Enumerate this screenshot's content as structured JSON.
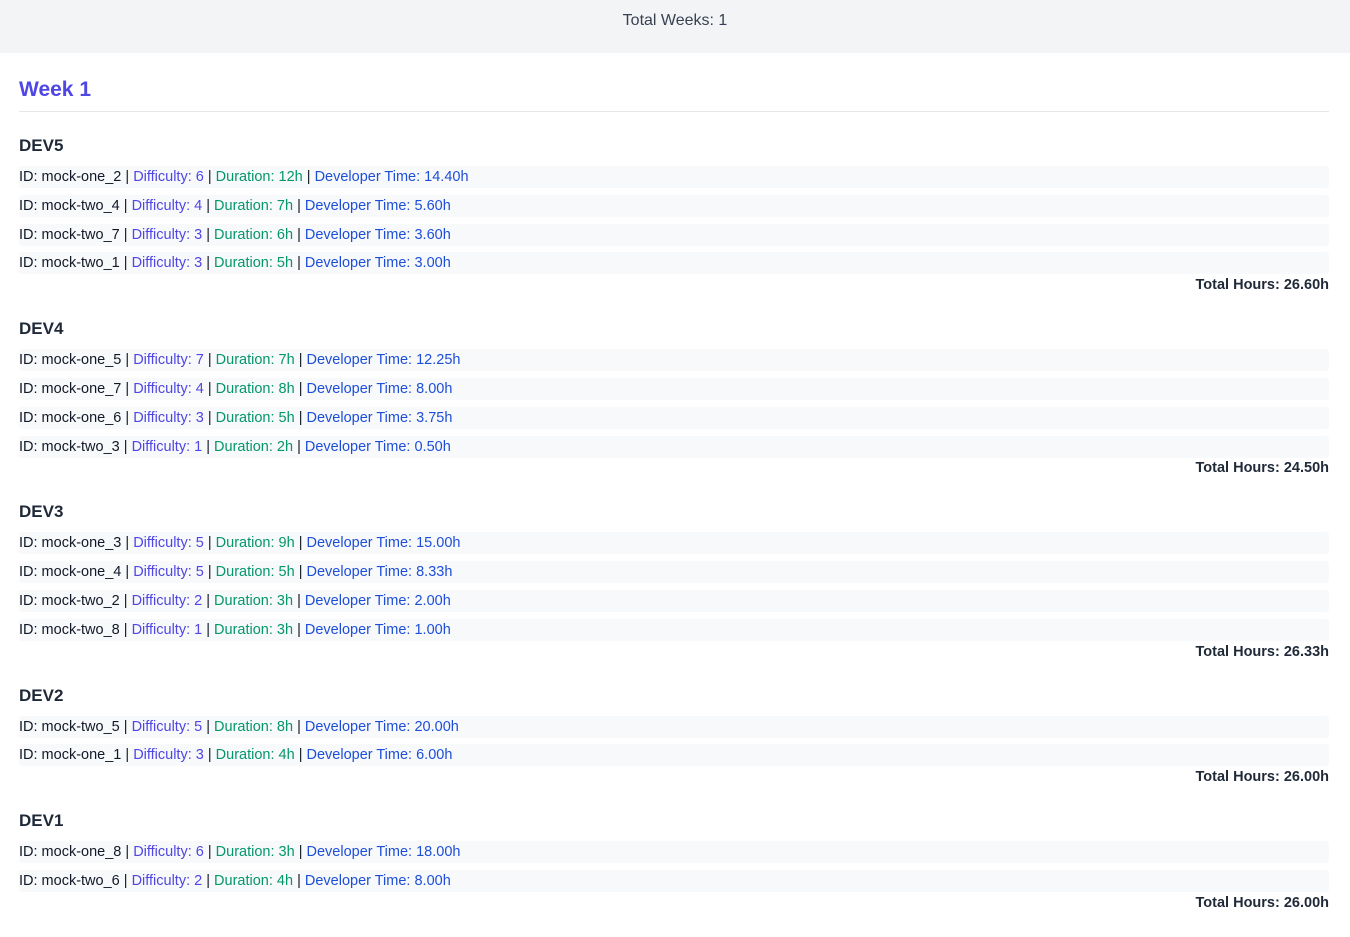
{
  "header": {
    "total_weeks": "Total Weeks: 1"
  },
  "week": {
    "title": "Week 1",
    "developers": [
      {
        "name": "DEV5",
        "total": "Total Hours: 26.60h",
        "tasks": [
          {
            "id": "ID: mock-one_2",
            "difficulty": "Difficulty: 6",
            "duration": "Duration: 12h",
            "dev_time": "Developer Time: 14.40h"
          },
          {
            "id": "ID: mock-two_4",
            "difficulty": "Difficulty: 4",
            "duration": "Duration: 7h",
            "dev_time": "Developer Time: 5.60h"
          },
          {
            "id": "ID: mock-two_7",
            "difficulty": "Difficulty: 3",
            "duration": "Duration: 6h",
            "dev_time": "Developer Time: 3.60h"
          },
          {
            "id": "ID: mock-two_1",
            "difficulty": "Difficulty: 3",
            "duration": "Duration: 5h",
            "dev_time": "Developer Time: 3.00h"
          }
        ]
      },
      {
        "name": "DEV4",
        "total": "Total Hours: 24.50h",
        "tasks": [
          {
            "id": "ID: mock-one_5",
            "difficulty": "Difficulty: 7",
            "duration": "Duration: 7h",
            "dev_time": "Developer Time: 12.25h"
          },
          {
            "id": "ID: mock-one_7",
            "difficulty": "Difficulty: 4",
            "duration": "Duration: 8h",
            "dev_time": "Developer Time: 8.00h"
          },
          {
            "id": "ID: mock-one_6",
            "difficulty": "Difficulty: 3",
            "duration": "Duration: 5h",
            "dev_time": "Developer Time: 3.75h"
          },
          {
            "id": "ID: mock-two_3",
            "difficulty": "Difficulty: 1",
            "duration": "Duration: 2h",
            "dev_time": "Developer Time: 0.50h"
          }
        ]
      },
      {
        "name": "DEV3",
        "total": "Total Hours: 26.33h",
        "tasks": [
          {
            "id": "ID: mock-one_3",
            "difficulty": "Difficulty: 5",
            "duration": "Duration: 9h",
            "dev_time": "Developer Time: 15.00h"
          },
          {
            "id": "ID: mock-one_4",
            "difficulty": "Difficulty: 5",
            "duration": "Duration: 5h",
            "dev_time": "Developer Time: 8.33h"
          },
          {
            "id": "ID: mock-two_2",
            "difficulty": "Difficulty: 2",
            "duration": "Duration: 3h",
            "dev_time": "Developer Time: 2.00h"
          },
          {
            "id": "ID: mock-two_8",
            "difficulty": "Difficulty: 1",
            "duration": "Duration: 3h",
            "dev_time": "Developer Time: 1.00h"
          }
        ]
      },
      {
        "name": "DEV2",
        "total": "Total Hours: 26.00h",
        "tasks": [
          {
            "id": "ID: mock-two_5",
            "difficulty": "Difficulty: 5",
            "duration": "Duration: 8h",
            "dev_time": "Developer Time: 20.00h"
          },
          {
            "id": "ID: mock-one_1",
            "difficulty": "Difficulty: 3",
            "duration": "Duration: 4h",
            "dev_time": "Developer Time: 6.00h"
          }
        ]
      },
      {
        "name": "DEV1",
        "total": "Total Hours: 26.00h",
        "tasks": [
          {
            "id": "ID: mock-one_8",
            "difficulty": "Difficulty: 6",
            "duration": "Duration: 3h",
            "dev_time": "Developer Time: 18.00h"
          },
          {
            "id": "ID: mock-two_6",
            "difficulty": "Difficulty: 2",
            "duration": "Duration: 4h",
            "dev_time": "Developer Time: 8.00h"
          }
        ]
      }
    ]
  }
}
